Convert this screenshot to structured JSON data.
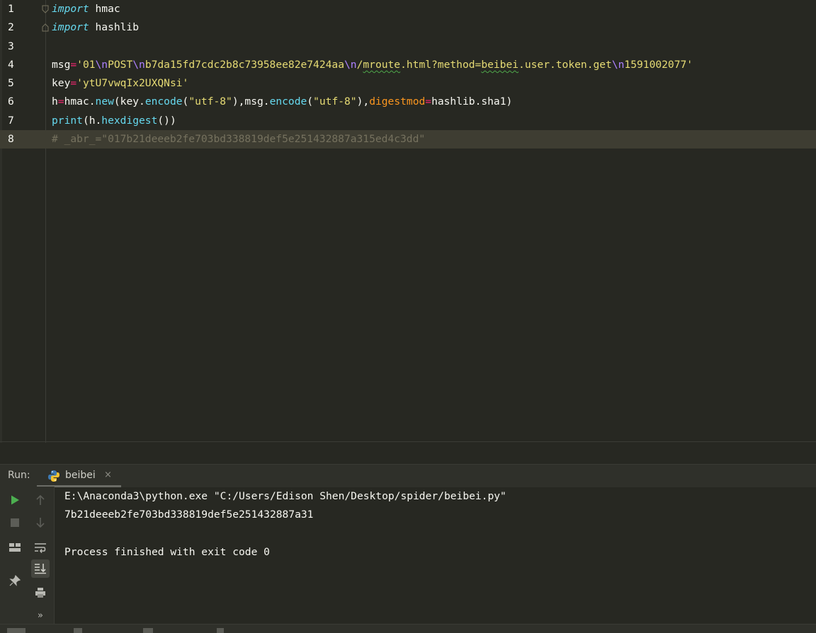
{
  "editor": {
    "line_numbers": [
      "1",
      "2",
      "3",
      "4",
      "5",
      "6",
      "7",
      "8"
    ],
    "lines": {
      "l1": {
        "kw": "import",
        "rest": " hmac"
      },
      "l2": {
        "kw": "import",
        "rest": " hashlib"
      },
      "l4": {
        "name": "msg",
        "eq": "=",
        "s1": "'01",
        "e1": "\\n",
        "s2": "POST",
        "e2": "\\n",
        "s3": "b7da15fd7cdc2b8c73958ee82e7424aa",
        "e3": "\\n",
        "s4": "/",
        "s5": "mroute",
        "s6": ".html?method=",
        "s7": "beibei",
        "s8": ".user.token.get",
        "e4": "\\n",
        "s9": "1591002077'"
      },
      "l5": {
        "name": "key",
        "eq": "=",
        "str": "'ytU7vwqIx2UXQNsi'"
      },
      "l6": {
        "p1": "h",
        "eq1": "=",
        "p2": "hmac.",
        "fn1": "new",
        "p3": "(key.",
        "fn2": "encode",
        "p4": "(",
        "str1": "\"utf-8\"",
        "p5": "),msg.",
        "fn3": "encode",
        "p6": "(",
        "str2": "\"utf-8\"",
        "p7": "),",
        "param": "digestmod",
        "eq2": "=",
        "p8": "hashlib.sha1)"
      },
      "l7": {
        "fn1": "print",
        "p1": "(h.",
        "fn2": "hexdigest",
        "p2": "())"
      },
      "l8": {
        "comment": "# _abr_=\"017b21deeeb2fe703bd338819def5e251432887a315ed4c3dd\""
      }
    }
  },
  "run_panel": {
    "title": "Run:",
    "tab_label": "beibei",
    "tab_close": "×",
    "more": "»",
    "console": [
      "E:\\Anaconda3\\python.exe \"C:/Users/Edison Shen/Desktop/spider/beibei.py\"",
      "7b21deeeb2fe703bd338819def5e251432887a31",
      "",
      "Process finished with exit code 0"
    ]
  },
  "colors": {
    "background": "#272822",
    "keyword": "#66d9ef",
    "string": "#e6db74",
    "operator": "#f92672",
    "escape": "#ae81ff",
    "param": "#fd971f",
    "comment": "#75715e",
    "run_green": "#4caf50"
  },
  "icons": [
    "fold-marker-icon",
    "python-file-icon",
    "close-icon",
    "run-icon",
    "stop-icon",
    "arrow-up-icon",
    "arrow-down-icon",
    "layout-icon",
    "soft-wrap-icon",
    "scroll-to-end-icon",
    "pin-icon",
    "print-icon",
    "more-icon"
  ]
}
